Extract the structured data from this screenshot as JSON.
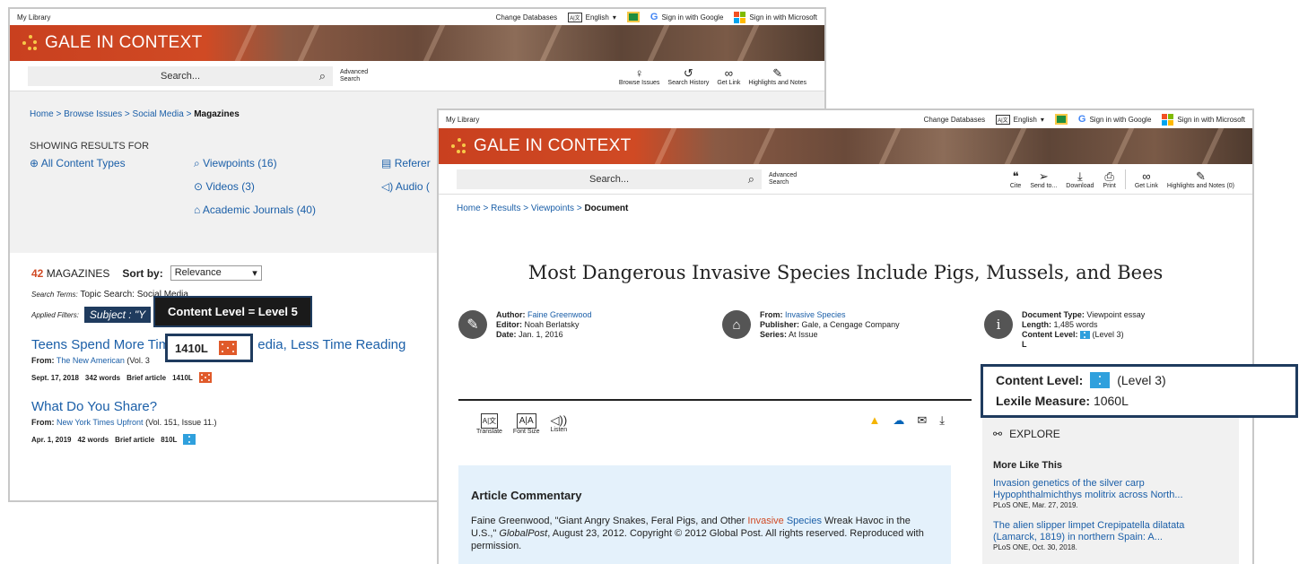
{
  "left": {
    "topbar": {
      "my_library": "My Library",
      "change_db": "Change Databases",
      "lang": "English",
      "sign_google": "Sign in with Google",
      "sign_ms": "Sign in with Microsoft"
    },
    "logo": "GALE IN CONTEXT",
    "search": {
      "placeholder": "Search...",
      "advanced_1": "Advanced",
      "advanced_2": "Search"
    },
    "tools": [
      {
        "icon": "lightbulb-icon",
        "label": "Browse Issues"
      },
      {
        "icon": "history-icon",
        "label": "Search History"
      },
      {
        "icon": "link-icon",
        "label": "Get Link"
      },
      {
        "icon": "pen-icon",
        "label": "Highlights and Notes"
      }
    ],
    "breadcrumb": {
      "home": "Home",
      "browse": "Browse Issues",
      "topic": "Social Media",
      "current": "Magazines",
      "sep": ">"
    },
    "showing": "SHOWING RESULTS FOR",
    "content_types": {
      "all": "All Content Types",
      "viewpoints": "Viewpoints (16)",
      "videos": "Videos (3)",
      "academic": "Academic Journals (40)",
      "reference": "Referer",
      "audio": "Audio ("
    },
    "results": {
      "count": "42",
      "count_label": "MAGAZINES",
      "sort_label": "Sort by:",
      "sort_value": "Relevance",
      "terms_label": "Search Terms:",
      "terms_value": "Topic Search: Social Media",
      "filters_label": "Applied Filters:",
      "filter_chip": "Subject : \"Y",
      "items": [
        {
          "title_a": "Teens Spend More Tim",
          "title_b": "edia, Less Time Reading",
          "from_label": "From:",
          "source": "The New American",
          "issue": "(Vol. 3",
          "date": "Sept. 17, 2018",
          "words": "342 words",
          "type": "Brief article",
          "lexile": "1410L"
        },
        {
          "title": "What Do You Share?",
          "from_label": "From:",
          "source": "New York Times Upfront",
          "issue": "(Vol. 151, Issue 11.)",
          "date": "Apr. 1, 2019",
          "words": "42 words",
          "type": "Brief article",
          "lexile": "810L"
        }
      ]
    },
    "tooltip": {
      "text": "Content Level = Level 5",
      "lexile": "1410L"
    }
  },
  "right": {
    "topbar": {
      "my_library": "My Library",
      "change_db": "Change Databases",
      "lang": "English",
      "sign_google": "Sign in with Google",
      "sign_ms": "Sign in with Microsoft"
    },
    "logo": "GALE IN CONTEXT",
    "search": {
      "placeholder": "Search...",
      "advanced_1": "Advanced",
      "advanced_2": "Search"
    },
    "tools": [
      {
        "icon": "quote-icon",
        "label": "Cite"
      },
      {
        "icon": "send-icon",
        "label": "Send to..."
      },
      {
        "icon": "download-icon",
        "label": "Download"
      },
      {
        "icon": "print-icon",
        "label": "Print"
      },
      {
        "icon": "link-icon",
        "label": "Get Link"
      },
      {
        "icon": "pen-icon",
        "label": "Highlights and Notes (0)"
      }
    ],
    "breadcrumb": {
      "home": "Home",
      "results": "Results",
      "viewpoints": "Viewpoints",
      "current": "Document",
      "sep": ">"
    },
    "doc_title": "Most Dangerous Invasive Species Include Pigs, Mussels, and Bees",
    "meta1": {
      "author_label": "Author:",
      "author": "Faine Greenwood",
      "editor_label": "Editor:",
      "editor": "Noah Berlatsky",
      "date_label": "Date:",
      "date": "Jan. 1, 2016"
    },
    "meta2": {
      "from_label": "From:",
      "from": "Invasive Species",
      "publisher_label": "Publisher:",
      "publisher": "Gale, a Cengage Company",
      "series_label": "Series:",
      "series": "At Issue"
    },
    "meta3": {
      "type_label": "Document Type:",
      "type": "Viewpoint essay",
      "length_label": "Length:",
      "length": "1,485 words",
      "level_label": "Content Level:",
      "level": "(Level 3)",
      "lexile_partial": "L"
    },
    "toolbar": {
      "translate": "Translate",
      "font_size": "Font Size",
      "listen": "Listen"
    },
    "commentary": {
      "heading": "Article Commentary",
      "text_a": "Faine Greenwood, \"Giant Angry Snakes, Feral Pigs, and Other ",
      "text_link1": "Invasive",
      "text_space": " ",
      "text_link2": "Species",
      "text_b": " Wreak Havoc in the U.S.,\" ",
      "text_em": "GlobalPost",
      "text_c": ", August 23, 2012. Copyright © 2012 Global Post. All rights reserved. Reproduced with permission."
    },
    "explore": {
      "heading": "EXPLORE",
      "more_like": "More Like This",
      "items": [
        {
          "title": "Invasion genetics of the silver carp Hypophthalmichthys molitrix across North...",
          "source": "PLoS ONE, Mar. 27, 2019."
        },
        {
          "title": "The alien slipper limpet Crepipatella dilatata (Lamarck, 1819) in northern Spain: A...",
          "source": "PLoS ONE, Oct. 30, 2018."
        }
      ]
    },
    "callout": {
      "level_label": "Content Level:",
      "level": "(Level 3)",
      "lexile_label": "Lexile Measure:",
      "lexile": "1060L"
    }
  },
  "colors": {
    "gale_orange": "#d04a24",
    "link_blue": "#1b5fa8",
    "tooltip_dark": "#1f3b5e",
    "level5": "#e05a2a",
    "level3": "#2fa0dd"
  }
}
